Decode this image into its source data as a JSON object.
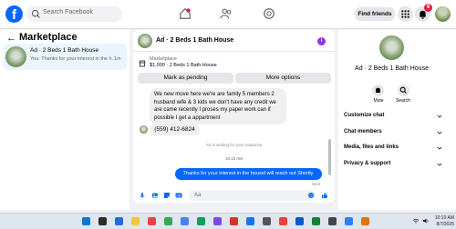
{
  "topbar": {
    "logo": "f",
    "search_placeholder": "Search Facebook",
    "find_friends": "Find friends",
    "notification_count": "9"
  },
  "left": {
    "back": "←",
    "title": "Marketplace",
    "conversation": {
      "title": "Ad · 2 Beds 1 Bath House",
      "preview": "You: Thanks for your interest in the h...",
      "time": "1m"
    }
  },
  "chat": {
    "title": "Ad · 2 Beds 1 Bath House",
    "marketplace_label": "Marketplace",
    "price_line": "$1,000 · 2 Beds 1 Bath House",
    "mark_pending": "Mark as pending",
    "more_options": "More options",
    "incoming_message": "We new move here we're are family 5 members 2 husband wife & 3 kids we don't have any credit we are came recently I proses my paper work can if possible I get a appartment",
    "phone_message": "(559) 412-6824",
    "waiting_note": "Ad is waiting for your response",
    "timestamp": "10:10 AM",
    "outgoing_message": "Thanks for your interest in the housel will reach out Shortly.",
    "sent_label": "Sent",
    "compose_placeholder": "Aa"
  },
  "details": {
    "title": "Ad · 2 Beds 1 Bath House",
    "mute": "Mute",
    "search": "Search",
    "items": [
      "Customize chat",
      "Chat members",
      "Media, files and links",
      "Privacy & support"
    ]
  },
  "taskbar": {
    "time": "10:10 AM",
    "date": "8/7/2025"
  },
  "colors": {
    "brand": "#0866ff",
    "badge": "#e41e3f",
    "selected_row": "#ebf5ff"
  }
}
